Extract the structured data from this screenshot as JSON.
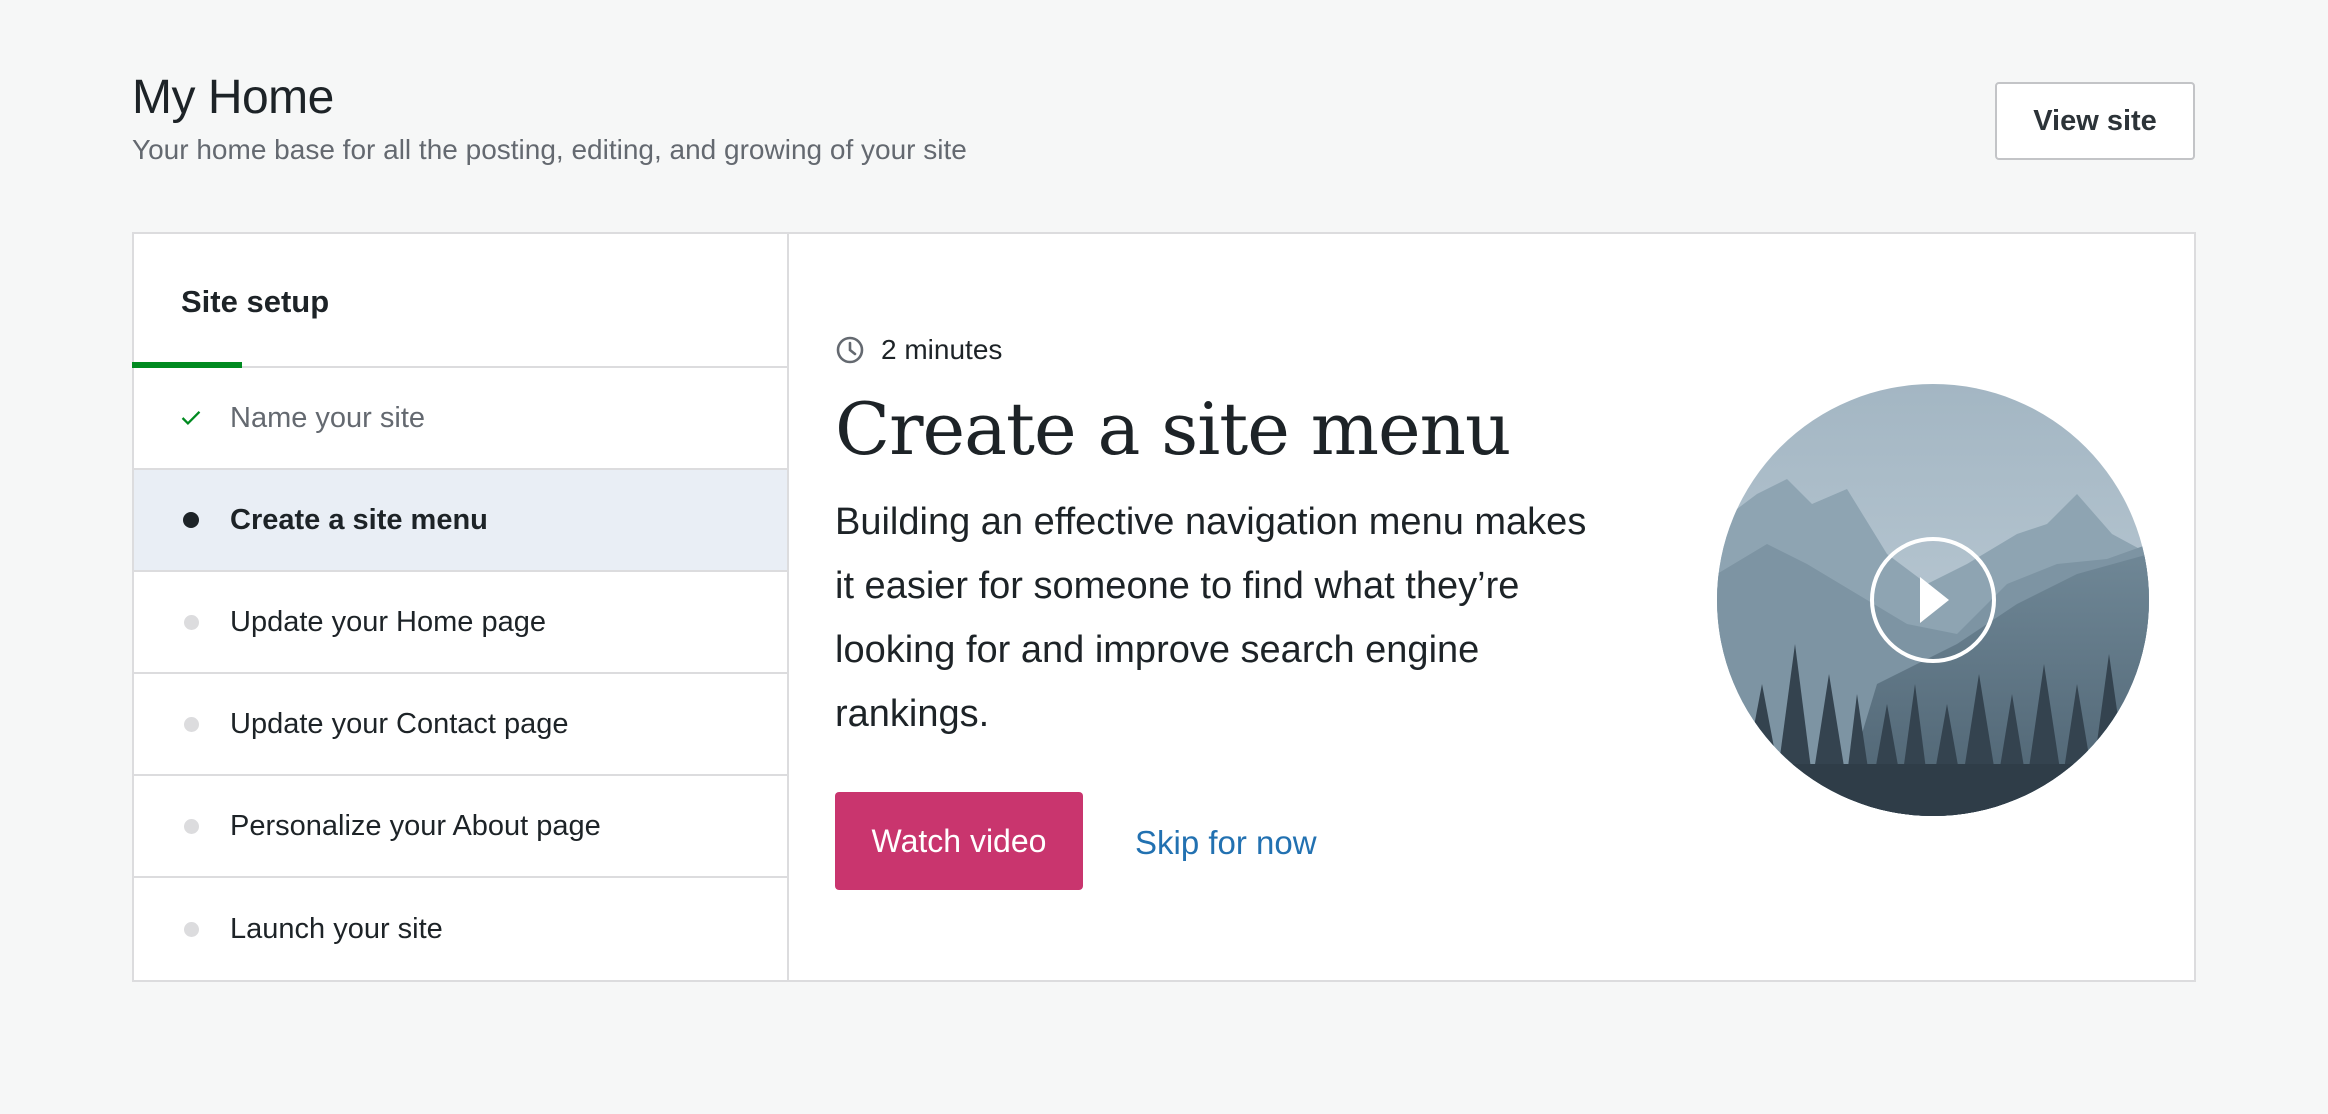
{
  "header": {
    "title": "My Home",
    "subtitle": "Your home base for all the posting, editing, and growing of your site",
    "view_site_label": "View site"
  },
  "setup": {
    "title": "Site setup",
    "tasks": [
      {
        "label": "Name your site",
        "status": "completed"
      },
      {
        "label": "Create a site menu",
        "status": "active"
      },
      {
        "label": "Update your Home page",
        "status": "pending"
      },
      {
        "label": "Update your Contact page",
        "status": "pending"
      },
      {
        "label": "Personalize your About page",
        "status": "pending"
      },
      {
        "label": "Launch your site",
        "status": "pending"
      }
    ]
  },
  "task": {
    "duration": "2 minutes",
    "title": "Create a site menu",
    "description": "Building an effective navigation menu makes it easier for someone to find what they’re looking for and improve search engine rankings.",
    "primary_label": "Watch video",
    "secondary_label": "Skip for now"
  },
  "colors": {
    "accent_green": "#008a20",
    "primary_button": "#c9356e",
    "link": "#2271b1",
    "active_row": "#e9eef5"
  }
}
